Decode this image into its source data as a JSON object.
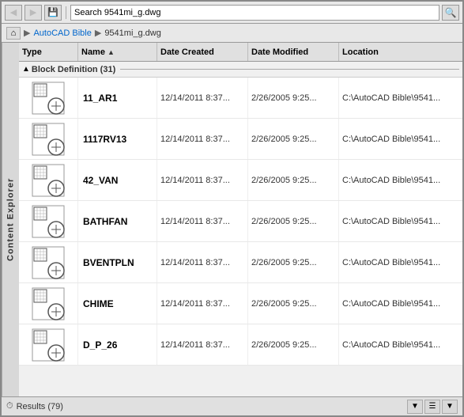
{
  "toolbar": {
    "search_placeholder": "Search 9541mi_g.dwg",
    "search_value": "Search 9541mi_g.dwg",
    "back_label": "◀",
    "forward_label": "▶",
    "up_label": "↑",
    "save_label": "💾",
    "home_label": "⌂",
    "search_icon": "🔍"
  },
  "breadcrumb": {
    "home_label": "⌂",
    "separator1": "▶",
    "link1": "AutoCAD Bible",
    "separator2": "▶",
    "current": "9541mi_g.dwg"
  },
  "side_label": "Content Explorer",
  "table": {
    "headers": {
      "type": "Type",
      "name": "Name",
      "date_created": "Date Created",
      "date_modified": "Date Modified",
      "location": "Location"
    },
    "group_label": "Block Definition (31)",
    "rows": [
      {
        "name": "11_AR1",
        "date_created": "12/14/2011 8:37...",
        "date_modified": "2/26/2005 9:25...",
        "location": "C:\\AutoCAD Bible\\9541..."
      },
      {
        "name": "1117RV13",
        "date_created": "12/14/2011 8:37...",
        "date_modified": "2/26/2005 9:25...",
        "location": "C:\\AutoCAD Bible\\9541..."
      },
      {
        "name": "42_VAN",
        "date_created": "12/14/2011 8:37...",
        "date_modified": "2/26/2005 9:25...",
        "location": "C:\\AutoCAD Bible\\9541..."
      },
      {
        "name": "BATHFAN",
        "date_created": "12/14/2011 8:37...",
        "date_modified": "2/26/2005 9:25...",
        "location": "C:\\AutoCAD Bible\\9541..."
      },
      {
        "name": "BVENTPLN",
        "date_created": "12/14/2011 8:37...",
        "date_modified": "2/26/2005 9:25...",
        "location": "C:\\AutoCAD Bible\\9541..."
      },
      {
        "name": "CHIME",
        "date_created": "12/14/2011 8:37...",
        "date_modified": "2/26/2005 9:25...",
        "location": "C:\\AutoCAD Bible\\9541..."
      },
      {
        "name": "D_P_26",
        "date_created": "12/14/2011 8:37...",
        "date_modified": "2/26/2005 9:25...",
        "location": "C:\\AutoCAD Bible\\9541..."
      }
    ]
  },
  "status": {
    "icon": "⏱",
    "text": "Results (79)",
    "filter_icon": "▼",
    "view_icon": "☰",
    "settings_icon": "▼"
  }
}
